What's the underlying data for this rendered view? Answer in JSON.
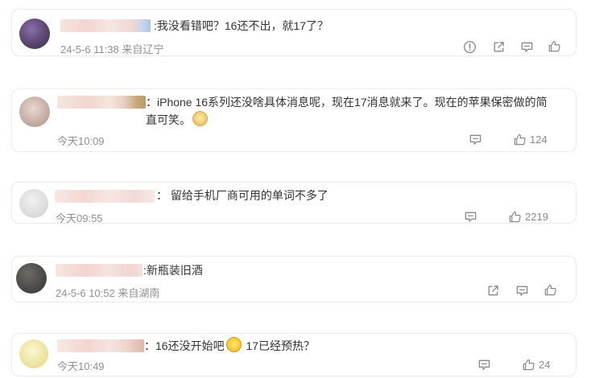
{
  "comments": [
    {
      "text": ":我没看错吧？16还不出，就17了？",
      "time": "24-5-6 11:38 来自辽宁",
      "likes": ""
    },
    {
      "text": "：iPhone 16系列还没啥具体消息呢，现在17消息就来了。现在的苹果保密做的简直可笑。",
      "emoji": "doge-emoji",
      "time": "今天10:09",
      "likes": "124"
    },
    {
      "text": "： 留给手机厂商可用的单词不多了",
      "time": "今天09:55",
      "likes": "2219"
    },
    {
      "text": ":新瓶装旧酒",
      "time": "24-5-6 10:52 来自湖南",
      "likes": ""
    },
    {
      "text_a": "：16还没开始吧",
      "emoji": "laugh-cry-emoji",
      "text_b": " 17已经预热？",
      "time": "今天10:49",
      "likes": "24"
    }
  ],
  "icons": {
    "report": "report-icon",
    "share": "share-icon",
    "reply": "reply-icon",
    "like": "thumbs-up-icon"
  },
  "colors": {
    "text": "#333333",
    "meta": "#909090",
    "icon": "#8a8a8a",
    "card_border": "#ececec"
  }
}
